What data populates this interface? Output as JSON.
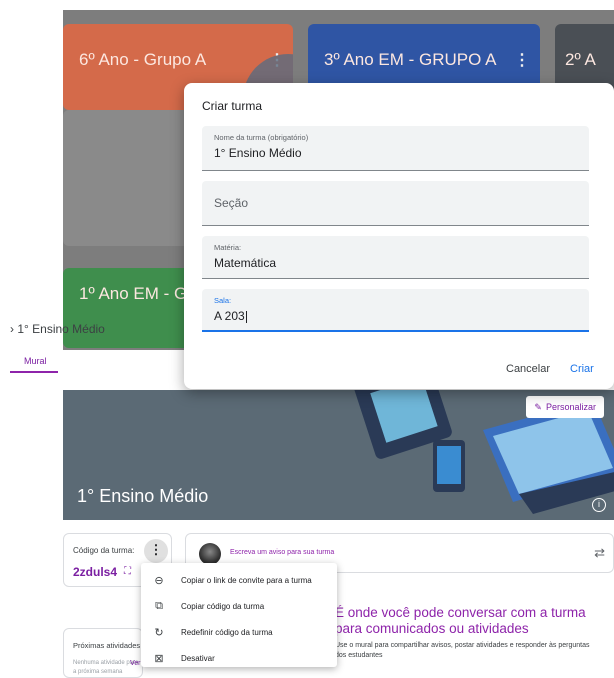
{
  "classes": [
    {
      "title": "6º Ano - Grupo A",
      "color": "#d46a4a"
    },
    {
      "title": "3º Ano EM - GRUPO A",
      "color": "#2f55a4"
    },
    {
      "title": "2º A",
      "color": "#4a4f55"
    },
    {
      "title": "1º Ano EM - G",
      "color": "#3f8e4d"
    }
  ],
  "breadcrumb": "1° Ensino Médio",
  "tabs": {
    "mural": "Mural"
  },
  "banner": {
    "title": "1° Ensino Médio",
    "customize_label": "Personalizar",
    "color": "#5b6a75"
  },
  "class_code": {
    "label": "Código da turma:",
    "value": "2zduls4"
  },
  "announce": {
    "placeholder": "Escreva um aviso para sua turma"
  },
  "upcoming": {
    "title": "Próximas atividades",
    "text": "Nenhuma atividade para a próxima semana",
    "link": "Ver"
  },
  "stream": {
    "heading": "É onde você pode conversar com a turma para comunicados ou atividades",
    "subtext": "Use o mural para compartilhar avisos, postar atividades e responder às perguntas dos estudantes"
  },
  "dialog": {
    "title": "Criar turma",
    "fields": [
      {
        "label": "Nome da turma (obrigatório)",
        "value": "1° Ensino Médio"
      },
      {
        "label": "",
        "placeholder": "Seção",
        "value": ""
      },
      {
        "label": "Matéria:",
        "value": "Matemática"
      },
      {
        "label": "Sala:",
        "value": "A 203"
      }
    ],
    "cancel_label": "Cancelar",
    "create_label": "Criar"
  },
  "menu": [
    {
      "icon": "link-icon",
      "label": "Copiar o link de convite para a turma"
    },
    {
      "icon": "copy-icon",
      "label": "Copiar código da turma"
    },
    {
      "icon": "reset-icon",
      "label": "Redefinir código da turma"
    },
    {
      "icon": "disable-icon",
      "label": "Desativar"
    }
  ],
  "colors": {
    "accent": "#1a73e8",
    "purple": "#8e24aa"
  }
}
